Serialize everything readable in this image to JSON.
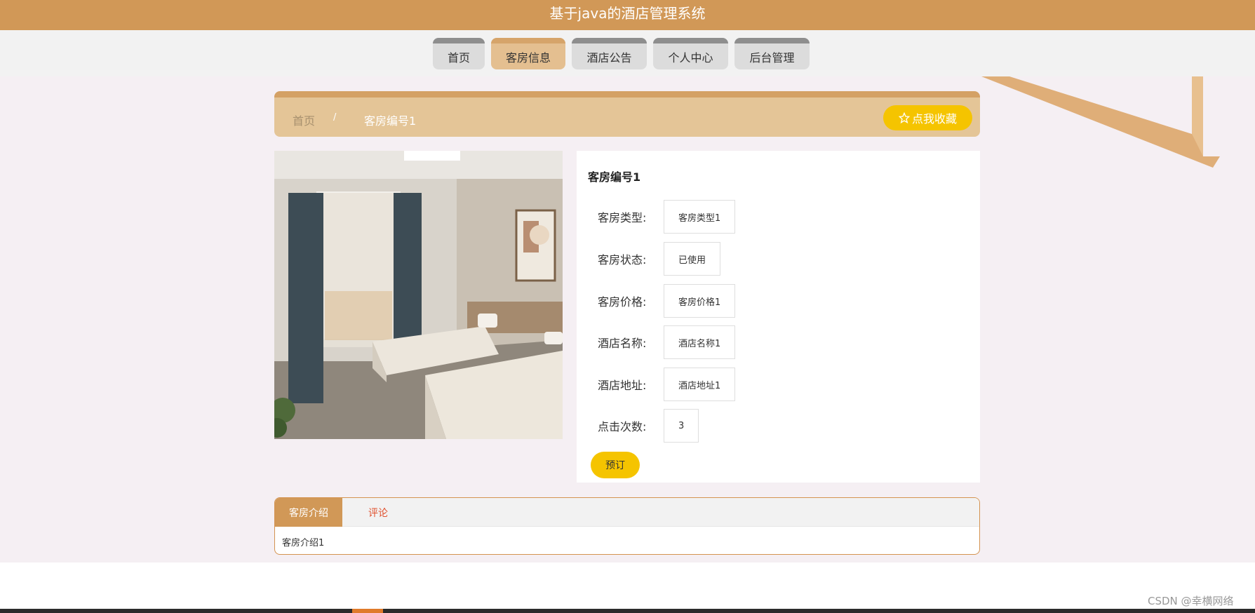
{
  "header": {
    "title": "基于java的酒店管理系统"
  },
  "nav": {
    "items": [
      {
        "label": "首页"
      },
      {
        "label": "客房信息"
      },
      {
        "label": "酒店公告"
      },
      {
        "label": "个人中心"
      },
      {
        "label": "后台管理"
      }
    ],
    "active_label": "客房信息"
  },
  "breadcrumb": {
    "home": "首页",
    "separator": "/",
    "current": "客房编号1"
  },
  "favorite_button": {
    "icon": "star-outline-icon",
    "label": "点我收藏"
  },
  "room": {
    "title": "客房编号1",
    "fields": [
      {
        "label": "客房类型:",
        "value": "客房类型1"
      },
      {
        "label": "客房状态:",
        "value": "已使用"
      },
      {
        "label": "客房价格:",
        "value": "客房价格1"
      },
      {
        "label": "酒店名称:",
        "value": "酒店名称1"
      },
      {
        "label": "酒店地址:",
        "value": "酒店地址1"
      },
      {
        "label": "点击次数:",
        "value": "3"
      }
    ],
    "book_label": "预订"
  },
  "tabs": {
    "items": [
      {
        "label": "客房介绍"
      },
      {
        "label": "评论"
      }
    ],
    "active_label": "客房介绍",
    "content": "客房介绍1"
  },
  "watermark": "CSDN @幸横网络",
  "colors": {
    "header_bg": "#d19857",
    "nav_active_bg": "#e4bf90",
    "accent_yellow": "#f5c400",
    "page_bg": "#f5eff3",
    "comment_tab_text": "#e0512f"
  }
}
